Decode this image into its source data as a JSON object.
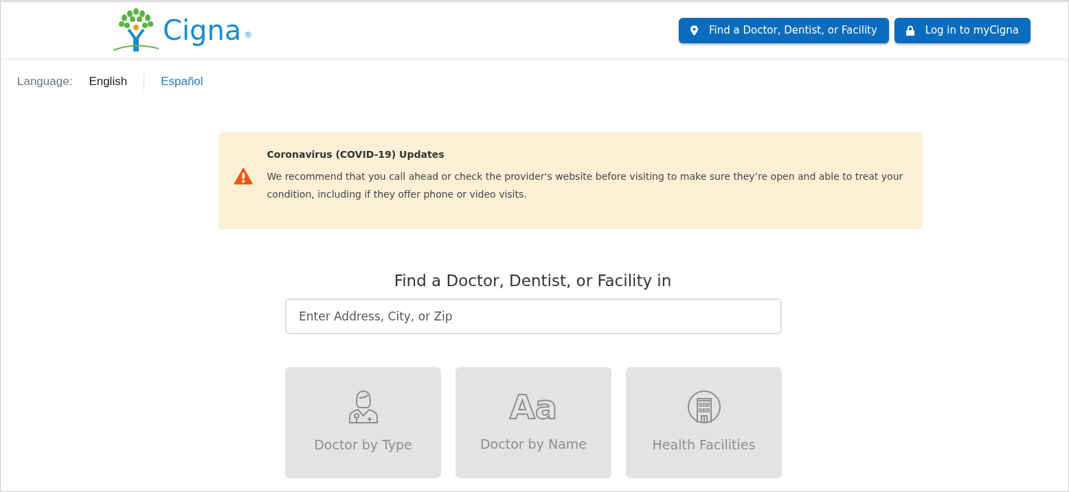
{
  "header": {
    "logo": {
      "wordmark": "Cigna",
      "registered": "®"
    },
    "buttons": [
      {
        "kind": "pin",
        "label": "Find a Doctor, Dentist, or Facility"
      },
      {
        "kind": "lock",
        "label": "Log in to myCigna"
      }
    ]
  },
  "language": {
    "label": "Language:",
    "options": [
      {
        "label": "English",
        "selected": true
      },
      {
        "label": "Español",
        "selected": false
      }
    ]
  },
  "alert": {
    "title": "Coronavirus (COVID-19) Updates",
    "message": "We recommend that you call ahead or check the provider's website before visiting to make sure they’re open and able to treat your condition, including if they offer phone or video visits."
  },
  "search": {
    "heading": "Find a Doctor, Dentist, or Facility in",
    "placeholder": "Enter Address, City, or Zip"
  },
  "tiles": [
    {
      "kind": "doctor",
      "label": "Doctor by Type"
    },
    {
      "kind": "name",
      "glyph": "Aa",
      "label": "Doctor by Name"
    },
    {
      "kind": "facility",
      "label": "Health Facilities"
    }
  ]
}
